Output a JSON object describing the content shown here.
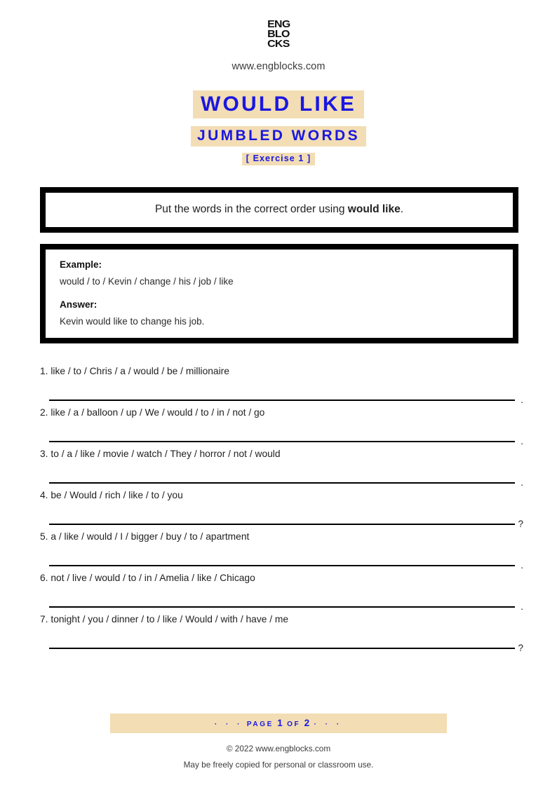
{
  "header": {
    "logo_lines": [
      "ENG",
      "BLO",
      "CKS"
    ],
    "site_url": "www.engblocks.com"
  },
  "titles": {
    "main": "WOULD LIKE",
    "sub": "JUMBLED WORDS",
    "exercise": "[ Exercise 1 ]"
  },
  "instruction": {
    "prefix": "Put the words in the correct order using ",
    "bold": "would like",
    "suffix": "."
  },
  "example": {
    "example_label": "Example:",
    "example_text": "would / to / Kevin / change / his / job / like",
    "answer_label": "Answer:",
    "answer_text": "Kevin would like to change his job."
  },
  "items": [
    {
      "number": "1.",
      "text": "like / to / Chris / a / would / be / millionaire",
      "mark": "."
    },
    {
      "number": "2.",
      "text": "like / a / balloon / up / We / would / to / in / not / go",
      "mark": "."
    },
    {
      "number": "3.",
      "text": "to / a / like / movie / watch / They / horror / not / would",
      "mark": "."
    },
    {
      "number": "4.",
      "text": "be / Would / rich / like / to / you",
      "mark": "?"
    },
    {
      "number": "5.",
      "text": "a / like / would / I / bigger / buy / to / apartment",
      "mark": "."
    },
    {
      "number": "6.",
      "text": "not / live / would / to / in / Amelia / like / Chicago",
      "mark": "."
    },
    {
      "number": "7.",
      "text": "tonight / you / dinner / to / like / Would / with / have / me",
      "mark": "?"
    }
  ],
  "footer": {
    "dots_left": "·  ·  ·",
    "page_word": "PAGE",
    "page_number": "1",
    "of_word": "OF",
    "total_pages": "2",
    "dots_right": "·  ·  ·",
    "copyright": "© 2022 www.engblocks.com",
    "license": "May be freely copied for personal or classroom use."
  },
  "colors": {
    "accent_blue": "#1a17e0",
    "highlight_tan": "#f2ddb4",
    "border_black": "#000000"
  }
}
